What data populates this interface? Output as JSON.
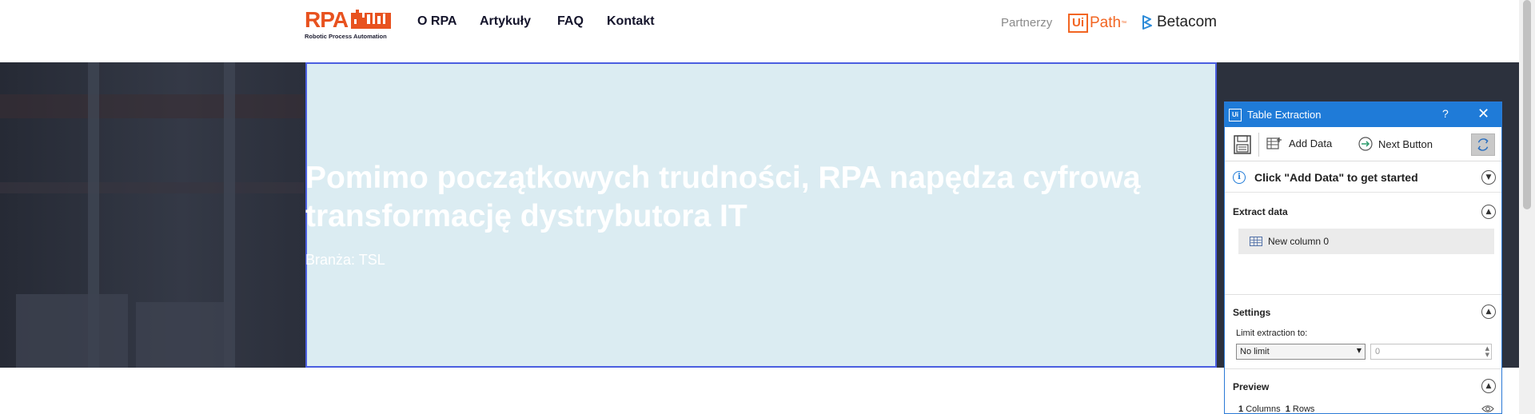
{
  "site": {
    "logo": {
      "main": "RPA",
      "subtitle": "Robotic Process Automation"
    },
    "nav": [
      "O RPA",
      "Artykuły",
      "FAQ",
      "Kontakt"
    ],
    "partners_label": "Partnerzy",
    "partner_uipath": {
      "boxed": "Ui",
      "text": "Path",
      "tm": "™"
    },
    "partner_betacom": "Betacom"
  },
  "hero": {
    "title": "Pomimo początkowych trudności, RPA napędza cyfrową transformację dystrybutora IT",
    "subtitle": "Branża: TSL"
  },
  "table_extraction": {
    "window_title": "Table Extraction",
    "help": "?",
    "close": "✕",
    "toolbar": {
      "add_data": "Add Data",
      "next_button": "Next Button"
    },
    "info": "Click \"Add Data\" to get started",
    "extract_section": "Extract data",
    "columns": [
      "New column 0"
    ],
    "settings_section": "Settings",
    "limit_label": "Limit extraction to:",
    "limit_option": "No limit",
    "limit_value": "0",
    "preview_section": "Preview",
    "preview_columns_count": "1",
    "preview_columns_label": "Columns",
    "preview_rows_count": "1",
    "preview_rows_label": "Rows"
  },
  "colors": {
    "brand_orange": "#e8521f",
    "uipath_orange": "#f26522",
    "selection_fill": "#dbecf2",
    "selection_border": "#4a5ee0",
    "titlebar_blue": "#1f7bd8"
  },
  "icons": [
    "skyline-icon",
    "betacom-logo-icon",
    "save-icon",
    "add-data-icon",
    "next-button-icon",
    "refresh-icon",
    "info-icon",
    "chevron-down-icon",
    "chevron-up-icon",
    "table-column-icon",
    "eye-icon"
  ]
}
